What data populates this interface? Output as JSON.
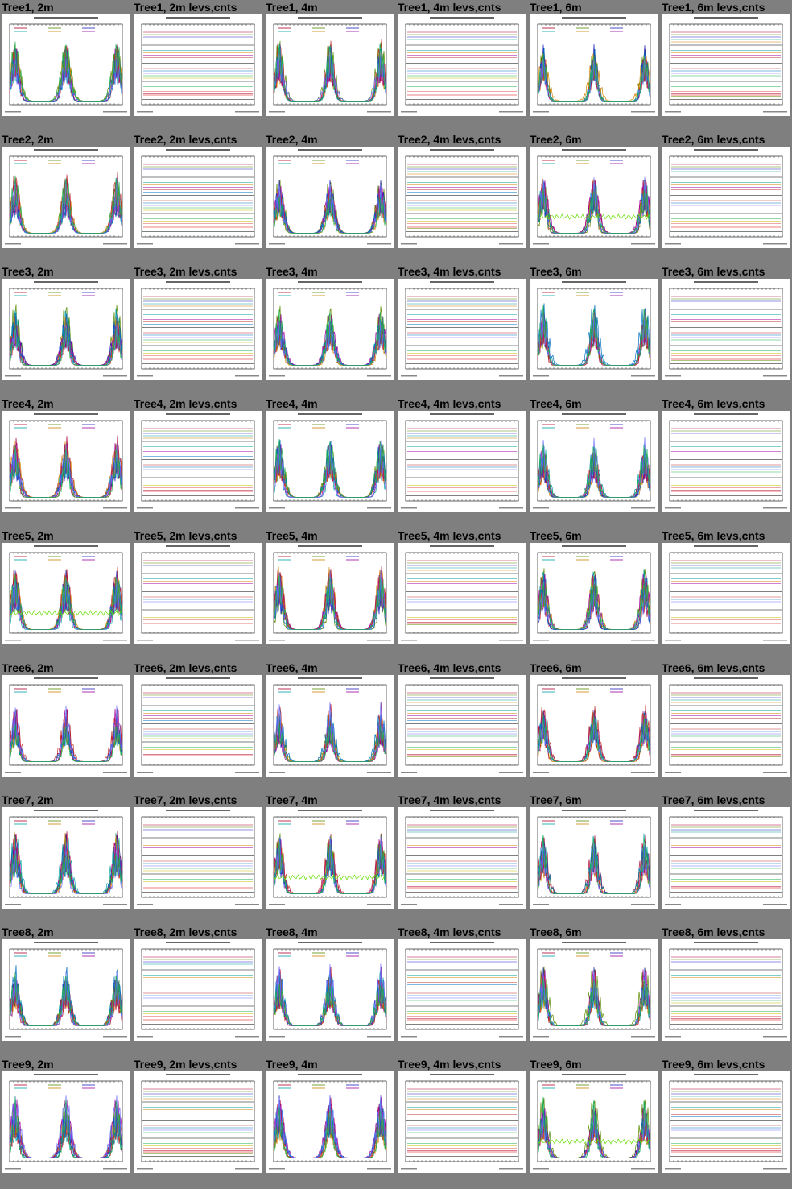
{
  "trees": [
    "Tree1",
    "Tree2",
    "Tree3",
    "Tree4",
    "Tree5",
    "Tree6",
    "Tree7",
    "Tree8",
    "Tree9"
  ],
  "panel_types": [
    "2m",
    "2m levs,cnts",
    "4m",
    "4m levs,cnts",
    "6m",
    "6m levs,cnts"
  ],
  "title_separator": ", ",
  "colors": {
    "background": "#7f7f7f",
    "panel": "#ffffff",
    "series": [
      "#b00030",
      "#5a8a00",
      "#2020c0",
      "#00a0a0",
      "#d08000",
      "#a000a0",
      "#c03030",
      "#0070c0",
      "#7070ff",
      "#20b050",
      "#c0c000",
      "#e05050"
    ],
    "accent_green": "#66dd00",
    "accent_red": "#dd0000"
  },
  "chart_data": {
    "type": "line",
    "layout": "grid",
    "rows": 9,
    "columns": 6,
    "description_panels": "Each thumbnail is a small line plot of multiple colored series over a time range; levs,cnts panels show stacked flat traces."
  }
}
